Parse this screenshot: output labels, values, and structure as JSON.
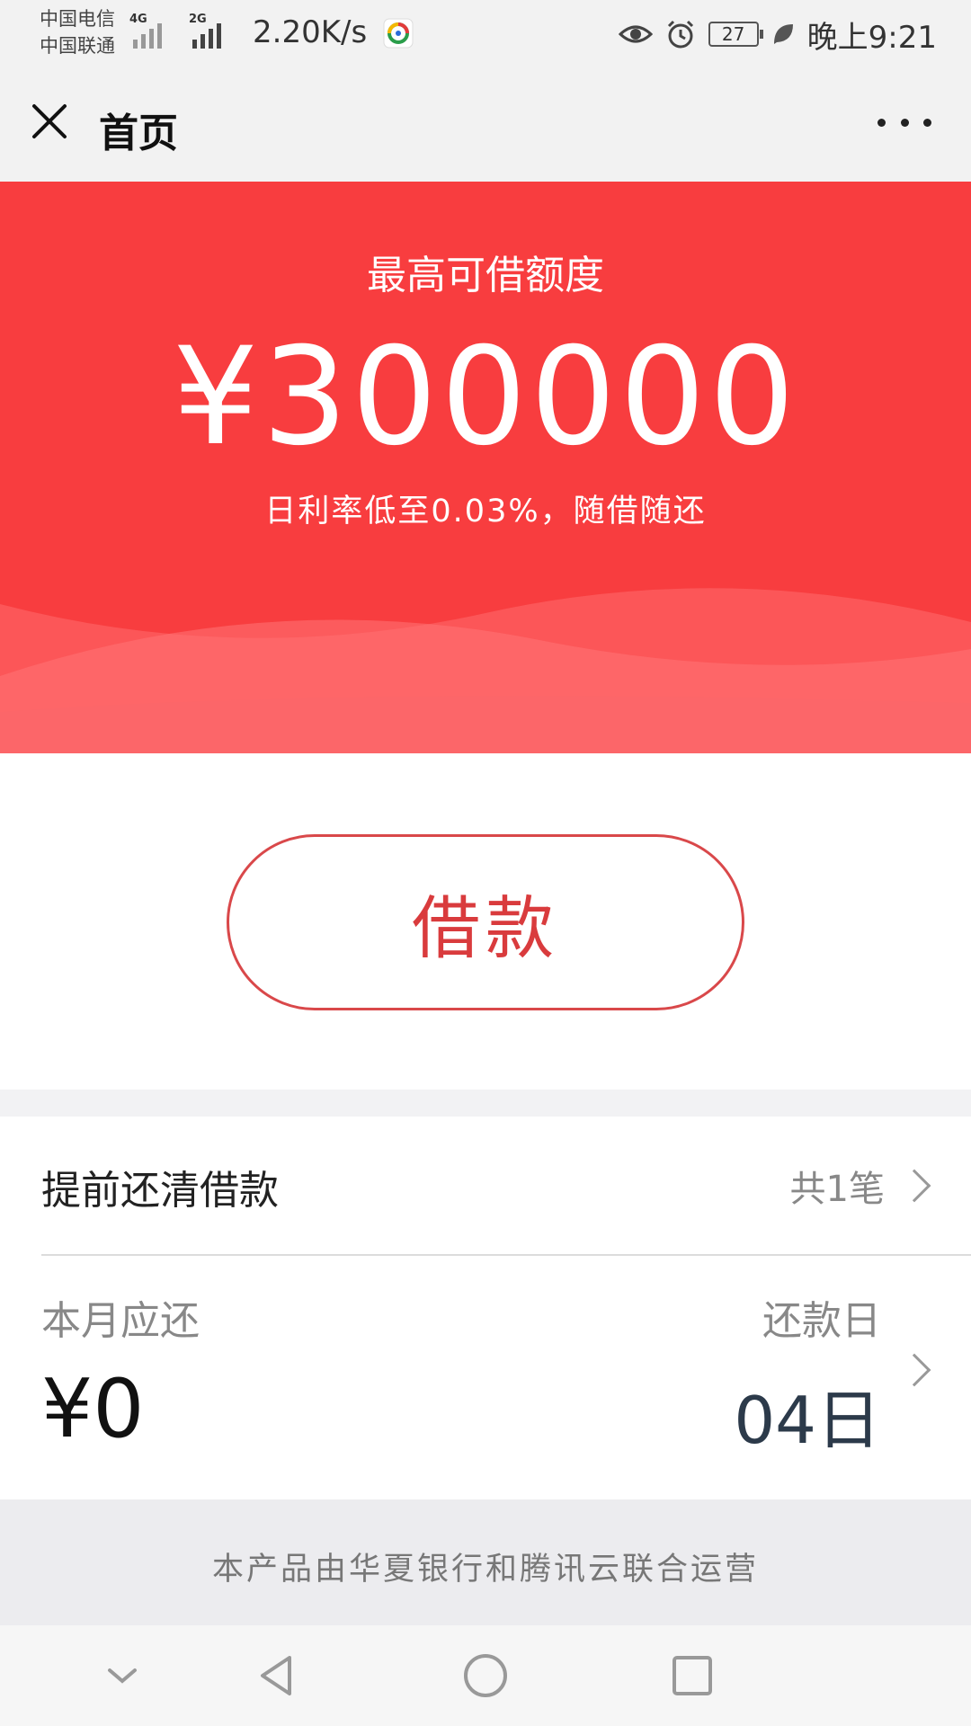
{
  "status_bar": {
    "carrier_1": "中国电信",
    "carrier_2": "中国联通",
    "network_1": "4G",
    "network_2": "2G",
    "speed": "2.20K/s",
    "battery": "27",
    "time": "晚上9:21",
    "icons": [
      "eye-icon",
      "alarm-icon",
      "battery-icon",
      "leaf-icon"
    ]
  },
  "header": {
    "title": "首页",
    "close_icon": "close-icon",
    "more_icon": "more-icon"
  },
  "hero": {
    "label": "最高可借额度",
    "amount": "¥300000",
    "subtitle": "日利率低至0.03%，随借随还",
    "bg_color": "#f83d3f"
  },
  "borrow": {
    "button_label": "借款",
    "accent": "#d93b3d"
  },
  "info": {
    "early_repay_label": "提前还清借款",
    "early_repay_count": "共1笔",
    "monthly_due_label": "本月应还",
    "monthly_due_value": "¥0",
    "payday_label": "还款日",
    "payday_value": "04日"
  },
  "footer": {
    "note": "本产品由华夏银行和腾讯云联合运营"
  },
  "nav_bar": {
    "icons": [
      "chevron-down-icon",
      "back-icon",
      "home-icon",
      "recents-icon"
    ]
  }
}
